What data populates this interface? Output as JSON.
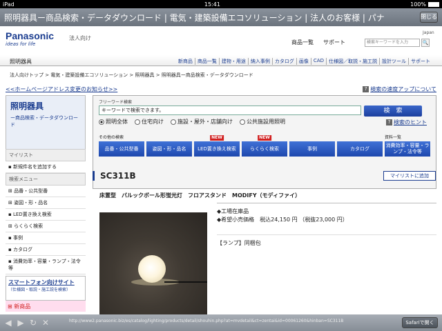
{
  "status": {
    "device": "iPad",
    "time": "15:41",
    "battery": "100%"
  },
  "titlebar": {
    "title": "照明器具ー商品検索・データダウンロード | 電気・建築設備エコソリューション | 法人のお客様 | パナ",
    "close_label": "閉じる"
  },
  "header": {
    "brand": "Panasonic",
    "tagline": "ideas for life",
    "corp_label": "法人向け",
    "japan": "Japan",
    "links": [
      "商品一覧",
      "サポート"
    ],
    "search_placeholder": "検索キーワードを入力",
    "search_icon": "magnifier-icon"
  },
  "navbar": {
    "label": "照明器具",
    "items": [
      "新商品",
      "商品一覧",
      "建物・用途",
      "納入事例",
      "カタログ",
      "画像",
      "CAD",
      "仕様図／取説・施工説",
      "設計ツール",
      "サポート"
    ]
  },
  "breadcrumb": "法人向けトップ > 電気・建築設備エコソリューション > 照明器具 > 照明器具ー商品検索・データダウンロード",
  "notice_link": "<<ホームページアドレス変更のお知らせ>>",
  "speedup_link": "検索の速度アップについて",
  "leftcat": {
    "title": "照明器具",
    "subtitle": "ー商品検索・データダウンロード"
  },
  "search": {
    "label": "フリーワード検索",
    "input_value": "キーワードで検索できます。",
    "button": "検　索",
    "radios": [
      {
        "label": "照明全体",
        "checked": true
      },
      {
        "label": "住宅向け",
        "checked": false
      },
      {
        "label": "施設・屋外・店舗向け",
        "checked": false
      },
      {
        "label": "公共施設用照明",
        "checked": false
      }
    ],
    "hint": "検索のヒント",
    "other_label": "その他の検索",
    "docs_label": "資料一覧",
    "buttons": [
      {
        "label": "品番・公共型番",
        "new": ""
      },
      {
        "label": "姿図・形・品名",
        "new": ""
      },
      {
        "label": "LED置き換え検索",
        "new": "NEW"
      },
      {
        "label": "らくらく検索",
        "new": "NEW"
      },
      {
        "label": "事例",
        "new": ""
      },
      {
        "label": "カタログ",
        "new": ""
      },
      {
        "label": "消費効率・容量・ランプ・法令等",
        "new": ""
      }
    ]
  },
  "mylist": {
    "header": "マイリスト",
    "add": "新規件名を追加する",
    "menu_header": "検索メニュー",
    "menu": [
      "品番・公共型番",
      "姿図・形・品名",
      "LED置き換え検索",
      "らくらく検索",
      "事例",
      "カタログ",
      "消費効率・容量・ランプ・法令等"
    ]
  },
  "smartphone": {
    "title": "スマートフォン向けサイト",
    "subtitle": "（仕様図・取説・施工説を検索）"
  },
  "newproducts": "新商品",
  "product": {
    "code": "SC311B",
    "add_button": "マイリストに追加",
    "description": "床置型　パルックボール形蛍光灯　フロアスタンド　MODIFY（モディファイ）",
    "stock": "◆工場在庫品",
    "price": "◆希望小売価格　税込24,150 円 （税抜23,000 円）",
    "lamp": "【ランプ】同梱包"
  },
  "bottombar": {
    "url": "http://www2.panasonic.biz/es/catalog/lighting/products/detail/shouhin.php?at=mvdetail&ct=zentai&id=00061260&hinban=SC311B",
    "safari": "Safariで開く"
  }
}
